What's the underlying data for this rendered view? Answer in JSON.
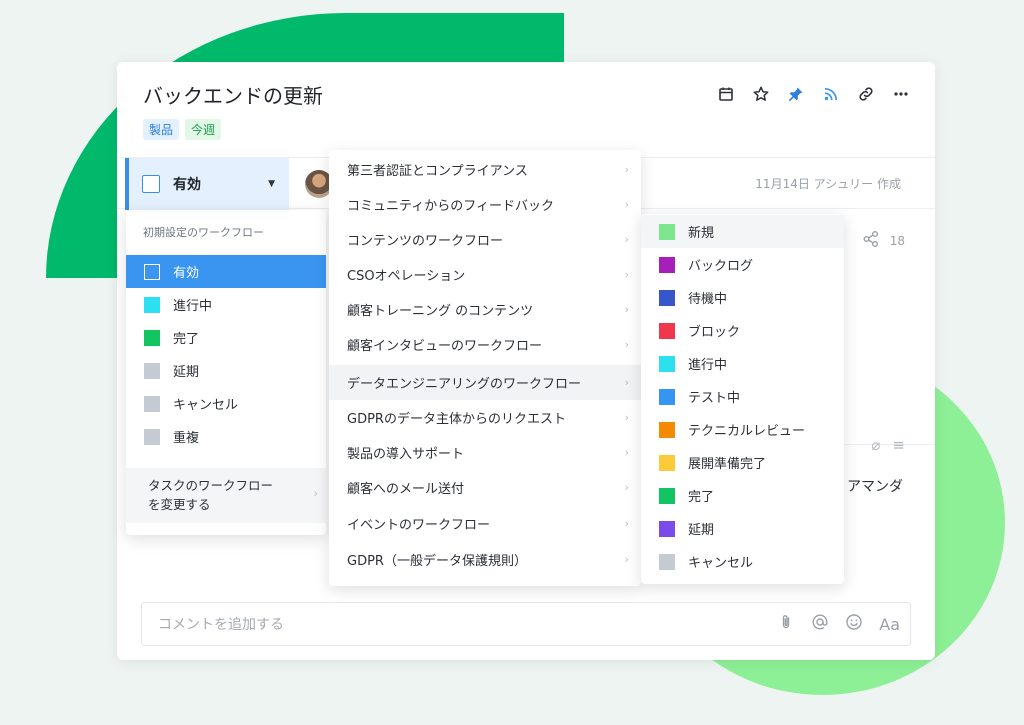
{
  "task": {
    "title": "バックエンドの更新",
    "tags": [
      {
        "label": "製品",
        "color": "#2f7fdc"
      },
      {
        "label": "今週",
        "color": "#1b9a4b"
      }
    ],
    "toolbar_icons": [
      "calendar-icon",
      "star-icon",
      "pin-icon",
      "rss-icon",
      "link-icon",
      "more-icon"
    ],
    "status": {
      "label": "有効",
      "color": "#3a8ee6"
    },
    "meta": "11月14日 アシュリー 作成",
    "share_count": "18",
    "assignee": "アマンダ"
  },
  "comment": {
    "placeholder": "コメントを追加する",
    "tools": [
      "attach-icon",
      "mention-icon",
      "emoji-icon",
      "format-icon"
    ],
    "format_label": "Aa"
  },
  "workflow_menu": {
    "heading": "初期設定のワークフロー",
    "items": [
      {
        "label": "有効",
        "color": "#3a8ee6",
        "style": "outline",
        "active": true
      },
      {
        "label": "進行中",
        "color": "#2ce0f0"
      },
      {
        "label": "完了",
        "color": "#13c463"
      },
      {
        "label": "延期",
        "color": "#c5cbd3"
      },
      {
        "label": "キャンセル",
        "color": "#c5cbd3"
      },
      {
        "label": "重複",
        "color": "#c5cbd3"
      }
    ],
    "change_label_line1": "タスクのワークフロー",
    "change_label_line2": "を変更する"
  },
  "workflows_list": {
    "items": [
      "第三者認証とコンプライアンス",
      "コミュニティからのフィードバック",
      "コンテンツのワークフロー",
      "CSOオペレーション",
      "顧客トレーニング のコンテンツ",
      "顧客インタビューのワークフロー",
      "データエンジニアリングのワークフロー",
      "GDPRのデータ主体からのリクエスト",
      "製品の導入サポート",
      "顧客へのメール送付",
      "イベントのワークフロー",
      "GDPR（一般データ保護規則）"
    ],
    "hovered": "データエンジニアリングのワークフロー"
  },
  "status_list": {
    "items": [
      {
        "label": "新規",
        "color": "#7ee68f"
      },
      {
        "label": "バックログ",
        "color": "#a51fb8"
      },
      {
        "label": "待機中",
        "color": "#3656c9"
      },
      {
        "label": "ブロック",
        "color": "#f0384d"
      },
      {
        "label": "進行中",
        "color": "#2ce0f0"
      },
      {
        "label": "テスト中",
        "color": "#3795f2"
      },
      {
        "label": "テクニカルレビュー",
        "color": "#f58a00"
      },
      {
        "label": "展開準備完了",
        "color": "#fccb3b"
      },
      {
        "label": "完了",
        "color": "#13c463"
      },
      {
        "label": "延期",
        "color": "#7a4be8"
      },
      {
        "label": "キャンセル",
        "color": "#c5cbd3"
      }
    ]
  }
}
